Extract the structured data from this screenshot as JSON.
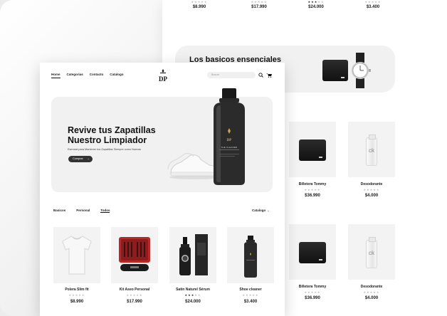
{
  "back_page": {
    "top_row": [
      {
        "stars": "★★★★★",
        "filled": 0,
        "price": "$8.990"
      },
      {
        "stars": "★★★★★",
        "filled": 0,
        "price": "$17.990"
      },
      {
        "stars": "★★★★★",
        "filled": 3,
        "price": "$24.000"
      },
      {
        "stars": "★★★★★",
        "filled": 0,
        "price": "$3.400"
      }
    ],
    "banner_title": "Los basicos ensenciales",
    "products": [
      {
        "name": "Billetera Tommy",
        "stars": "★★★★★",
        "price": "$36.990"
      },
      {
        "name": "Desodorante",
        "stars": "★★★★★",
        "price": "$4.000"
      },
      {
        "name": "Billetera Tommy",
        "stars": "★★★★★",
        "price": "$36.990"
      },
      {
        "name": "Desodorante",
        "stars": "★★★★★",
        "price": "$4.000"
      }
    ],
    "ck_label": "ck"
  },
  "front_page": {
    "nav": [
      "Home",
      "Categorias",
      "Contacto",
      "Catalogo"
    ],
    "search_placeholder": "Buscar",
    "hero": {
      "title": "Revive tus Zapatillas Nuestro Limpiador",
      "subtitle": "Esencial para Mantener tus Zapatillas Siempre como Nuevas",
      "button": "Comprar",
      "button_arrow": "→",
      "bottle_label": "THE CLEANER"
    },
    "filters": [
      "Basicos",
      "Personal",
      "Todos"
    ],
    "catalog_link": "Catalogo →",
    "products": [
      {
        "name": "Polera Slim fit",
        "stars": "★★★★★",
        "price": "$8.990"
      },
      {
        "name": "Kit  Aseo Personal",
        "stars": "★★★★★",
        "price": "$17.990"
      },
      {
        "name": "Satin Naturel Sérum",
        "stars": "★★★★★",
        "price": "$24.000"
      },
      {
        "name": "Shoe cleaner",
        "stars": "★★★★★",
        "price": "$3.400"
      }
    ]
  },
  "colors": {
    "accent": "#1c1c1c",
    "button": "#333333",
    "panel": "#f1f1f1"
  }
}
